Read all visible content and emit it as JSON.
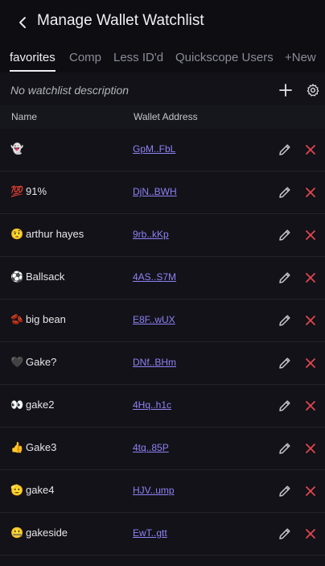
{
  "header": {
    "title": "Manage Wallet Watchlist"
  },
  "tabs": [
    {
      "label": "favorites",
      "active": true
    },
    {
      "label": "Comp",
      "active": false
    },
    {
      "label": "Less ID'd",
      "active": false
    },
    {
      "label": "Quickscope Users",
      "active": false
    }
  ],
  "new_tab_label": "+New",
  "description": {
    "text": "No watchlist description"
  },
  "table": {
    "columns": [
      "Name",
      "Wallet Address"
    ],
    "rows": [
      {
        "emoji": "👻",
        "name": "",
        "address": "GpM..FbL"
      },
      {
        "emoji": "💯",
        "name": "91%",
        "address": "DjN..BWH"
      },
      {
        "emoji": "🤨",
        "name": "arthur hayes",
        "address": "9rb..kKp"
      },
      {
        "emoji": "⚽",
        "name": "Ballsack",
        "address": "4AS..S7M"
      },
      {
        "emoji": "🫘",
        "name": "big bean",
        "address": "E8F..wUX"
      },
      {
        "emoji": "🖤",
        "name": "Gake?",
        "address": "DNf..BHm"
      },
      {
        "emoji": "👀",
        "name": "gake2",
        "address": "4Hq..h1c"
      },
      {
        "emoji": "👍",
        "name": "Gake3",
        "address": "4tq..85P"
      },
      {
        "emoji": "🫡",
        "name": "gake4",
        "address": "HJV..ump"
      },
      {
        "emoji": "🤐",
        "name": "gakeside",
        "address": "EwT..gtt"
      }
    ]
  },
  "colors": {
    "background": "#121218",
    "header_bg": "#0d0d12",
    "link": "#8f82f6",
    "delete": "#e0464e",
    "muted": "#8c8c98"
  }
}
